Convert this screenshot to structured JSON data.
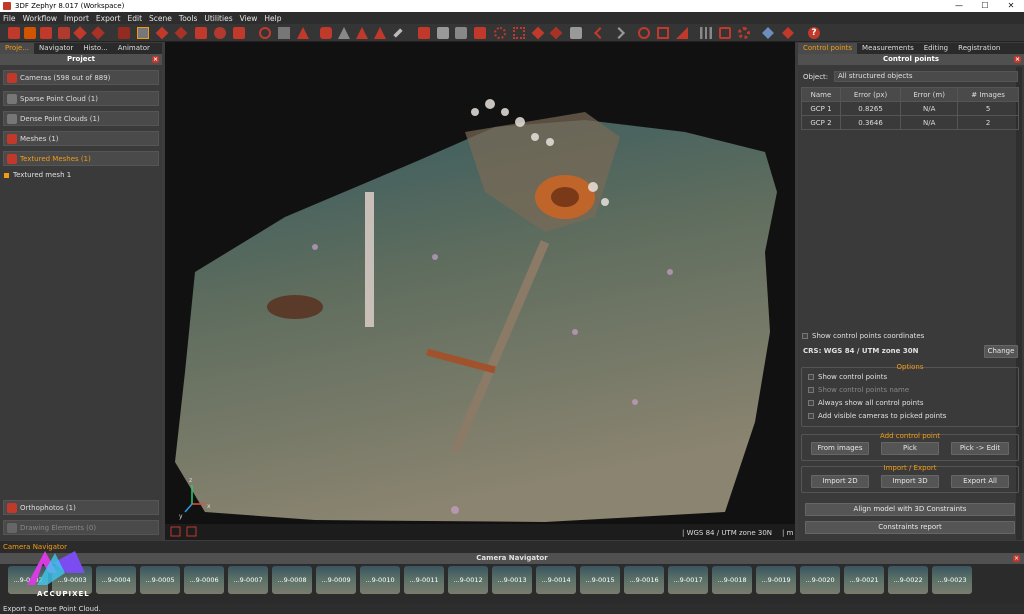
{
  "window": {
    "title": "3DF Zephyr 8.017 (Workspace)",
    "controls": [
      "—",
      "☐",
      "✕"
    ]
  },
  "menu": [
    "File",
    "Workflow",
    "Import",
    "Export",
    "Edit",
    "Scene",
    "Tools",
    "Utilities",
    "View",
    "Help"
  ],
  "left_panel": {
    "tabs": [
      "Proje...",
      "Navigator",
      "Histo...",
      "Animator"
    ],
    "title": "Project",
    "items": [
      "Cameras (598 out of 889)",
      "Sparse Point Cloud (1)",
      "Dense Point Clouds (1)",
      "Meshes (1)",
      "Textured Meshes (1)"
    ],
    "sub_item": "Textured mesh 1",
    "bottom_items": [
      "Orthophotos (1)",
      "Drawing Elements (0)"
    ]
  },
  "viewport": {
    "crs_label": "| WGS 84 / UTM zone 30N",
    "unit_label": "| m",
    "axis_x": "x",
    "axis_y": "y",
    "axis_z": "z"
  },
  "right_panel": {
    "tabs": [
      "Control points",
      "Measurements",
      "Editing",
      "Registration"
    ],
    "title": "Control points",
    "object_label": "Object:",
    "object_value": "All structured objects",
    "table": {
      "headers": [
        "Name",
        "Error (px)",
        "Error (m)",
        "# Images"
      ],
      "rows": [
        [
          "GCP 1",
          "0.8265",
          "N/A",
          "5"
        ],
        [
          "GCP 2",
          "0.3646",
          "N/A",
          "2"
        ]
      ]
    },
    "show_coords": "Show control points coordinates",
    "crs_text": "CRS: WGS 84 / UTM zone 30N",
    "change_label": "Change",
    "options_title": "Options",
    "options": [
      "Show control points",
      "Show control points name",
      "Always show all control points",
      "Add visible cameras to picked points"
    ],
    "add_title": "Add control point",
    "add_buttons": [
      "From images",
      "Pick",
      "Pick -> Edit"
    ],
    "io_title": "Import / Export",
    "io_buttons": [
      "Import 2D",
      "Import 3D",
      "Export All"
    ],
    "align_label": "Align model with 3D Constraints",
    "report_label": "Constraints report"
  },
  "camera_navigator": {
    "tab": "Camera Navigator",
    "title": "Camera Navigator",
    "thumbs": [
      "...9-0002",
      "...9-0003",
      "...9-0004",
      "...9-0005",
      "...9-0006",
      "...9-0007",
      "...9-0008",
      "...9-0009",
      "...9-0010",
      "...9-0011",
      "...9-0012",
      "...9-0013",
      "...9-0014",
      "...9-0015",
      "...9-0016",
      "...9-0017",
      "...9-0018",
      "...9-0019",
      "...9-0020",
      "...9-0021",
      "...9-0022",
      "...9-0023"
    ]
  },
  "watermark": "ACCUPIXEL",
  "status": "Export a Dense Point Cloud."
}
